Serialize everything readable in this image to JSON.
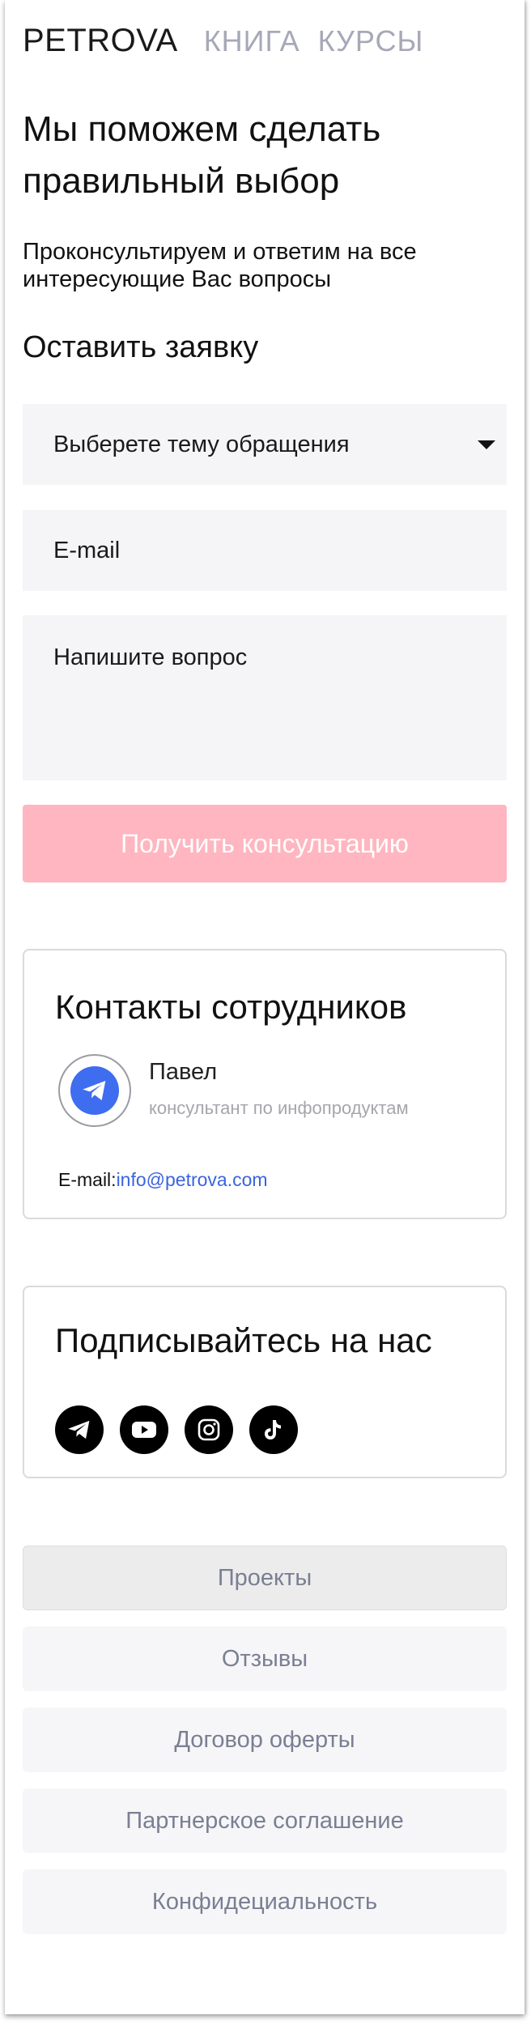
{
  "nav": {
    "logo": "PETROVA",
    "links": [
      "КНИГА",
      "КУРСЫ"
    ]
  },
  "hero": {
    "title_line1": "Мы поможем сделать",
    "title_line2": "правильный выбор",
    "subtitle_line1": "Проконсультируем и ответим на все",
    "subtitle_line2": "интересующие Вас вопросы"
  },
  "form": {
    "title": "Оставить заявку",
    "topic_placeholder": "Выберете тему обращения",
    "email_placeholder": "E-mail",
    "question_placeholder": "Напишите вопрос",
    "submit_label": "Получить консультацию"
  },
  "contacts": {
    "title": "Контакты сотрудников",
    "person_name": "Павел",
    "person_role": "консультант по инфопродуктам",
    "email_label": "E-mail:",
    "email_value": "info@petrova.com"
  },
  "social": {
    "title": "Подписывайтесь на нас",
    "icons": [
      "telegram-icon",
      "youtube-icon",
      "instagram-icon",
      "tiktok-icon"
    ]
  },
  "footer": {
    "links": [
      "Проекты",
      "Отзывы",
      "Договор оферты",
      "Партнерское соглашение",
      "Конфидециальность"
    ]
  },
  "colors": {
    "submit_bg": "#ffb6c0",
    "link": "#3a64e0",
    "avatar": "#3f6df0",
    "nav_muted": "#a7a8b7"
  }
}
